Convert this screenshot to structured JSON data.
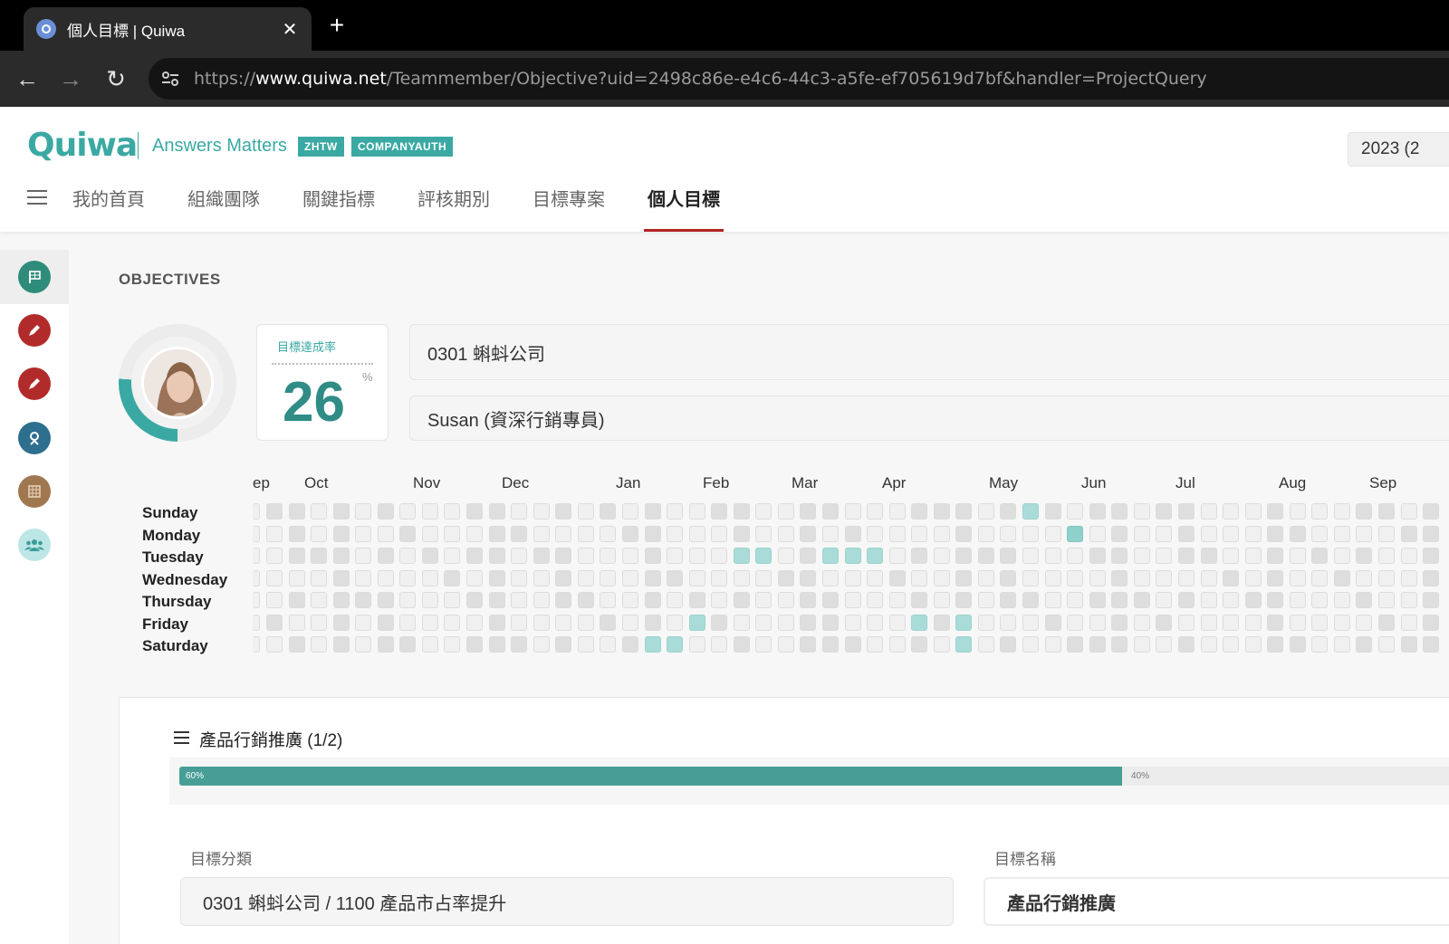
{
  "browser": {
    "tab_title": "個人目標 | Quiwa",
    "url_prefix": "https://",
    "url_host": "www.quiwa.net",
    "url_path": "/Teammember/Objective?uid=2498c86e-e4c6-44c3-a5fe-ef705619d7bf&handler=ProjectQuery"
  },
  "header": {
    "logo": "Quiwa",
    "tagline": "Answers Matters",
    "badges": [
      "ZHTW",
      "COMPANYAUTH"
    ],
    "year_selector": "2023 (2"
  },
  "nav": {
    "items": [
      "我的首頁",
      "組織團隊",
      "關鍵指標",
      "評核期別",
      "目標專案",
      "個人目標"
    ],
    "active_index": 5
  },
  "siderail": {
    "icons": [
      {
        "name": "flag-icon",
        "color": "#2f8c7a"
      },
      {
        "name": "pen-icon",
        "color": "#b22b2b"
      },
      {
        "name": "pen-icon",
        "color": "#b22b2b"
      },
      {
        "name": "award-icon",
        "color": "#2e6e8e"
      },
      {
        "name": "building-icon",
        "color": "#a07850"
      },
      {
        "name": "team-icon",
        "color": "#bde6e6"
      }
    ]
  },
  "objectives": {
    "section_title": "OBJECTIVES",
    "rate_label": "目標達成率",
    "rate_value": "26",
    "rate_unit": "%",
    "progress_fraction": 0.26,
    "company": "0301 蝌蚪公司",
    "member": "Susan (資深行銷專員)"
  },
  "heatmap": {
    "months": [
      "ep",
      "Oct",
      "Nov",
      "Dec",
      "Jan",
      "Feb",
      "Mar",
      "Apr",
      "May",
      "Jun",
      "Jul",
      "Aug",
      "Sep"
    ],
    "days": [
      "Sunday",
      "Monday",
      "Tuesday",
      "Wednesday",
      "Thursday",
      "Friday",
      "Saturday"
    ],
    "highlighted": [
      {
        "week": 34,
        "day": 0,
        "level": 1
      },
      {
        "week": 36,
        "day": 1,
        "level": 2
      },
      {
        "week": 21,
        "day": 2,
        "level": 1
      },
      {
        "week": 22,
        "day": 2,
        "level": 1
      },
      {
        "week": 25,
        "day": 2,
        "level": 1
      },
      {
        "week": 26,
        "day": 2,
        "level": 1
      },
      {
        "week": 27,
        "day": 2,
        "level": 1
      },
      {
        "week": 19,
        "day": 5,
        "level": 1
      },
      {
        "week": 29,
        "day": 5,
        "level": 1
      },
      {
        "week": 31,
        "day": 5,
        "level": 1
      },
      {
        "week": 17,
        "day": 6,
        "level": 1
      },
      {
        "week": 18,
        "day": 6,
        "level": 1
      },
      {
        "week": 31,
        "day": 6,
        "level": 1
      }
    ],
    "colors": {
      "empty_light": "#f0f0f0",
      "empty_dark": "#dedede",
      "level1": "#a9dcd8",
      "level2": "#8fd0ca"
    }
  },
  "project": {
    "title": "產品行銷推廣 (1/2)",
    "done_fraction": 0.6,
    "done_label": "60%",
    "remaining_label": "40%",
    "category_label": "目標分類",
    "category_value": "0301 蝌蚪公司 / 1100 產品市占率提升",
    "name_label": "目標名稱",
    "name_value": "產品行銷推廣"
  }
}
